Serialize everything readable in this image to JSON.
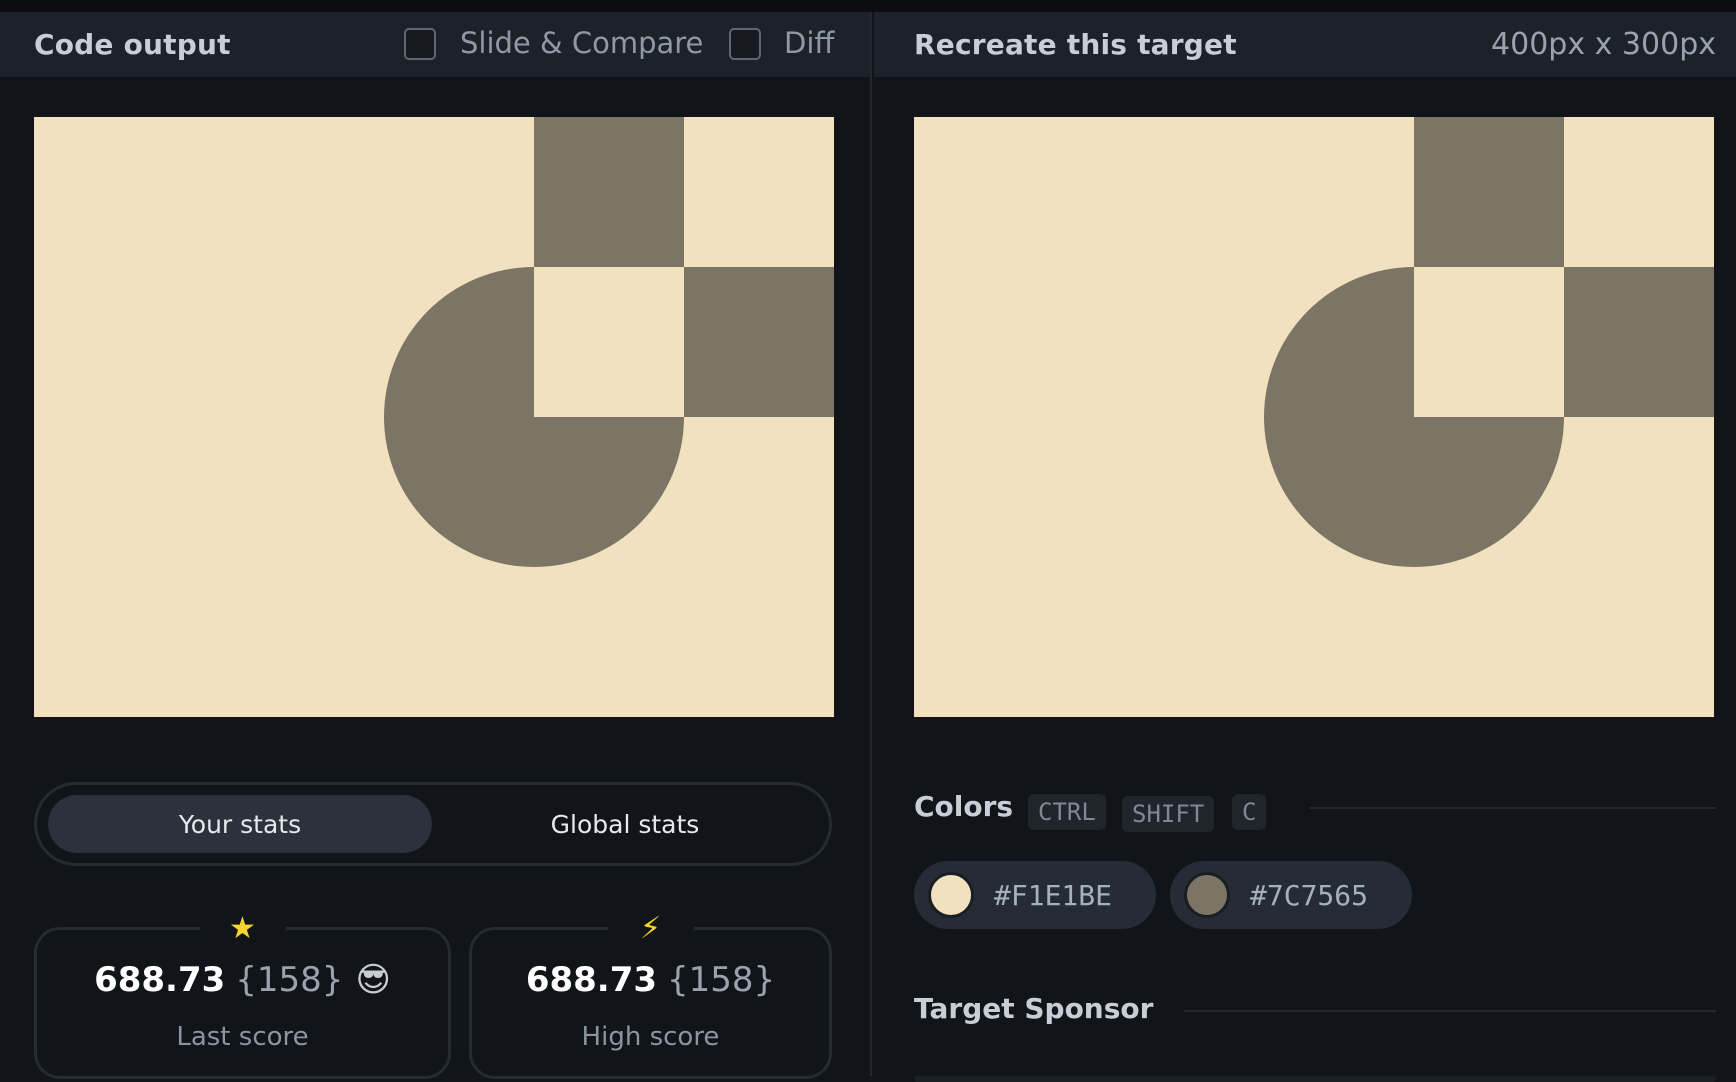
{
  "left_panel": {
    "title": "Code output",
    "slide_compare_label": "Slide & Compare",
    "diff_label": "Diff"
  },
  "right_panel": {
    "title": "Recreate this target",
    "dimensions": "400px x 300px"
  },
  "target_colors": {
    "background": "#F1E1BE",
    "foreground": "#7C7565"
  },
  "stats": {
    "tabs": [
      "Your stats",
      "Global stats"
    ],
    "active_tab": "Your stats",
    "last_score": {
      "icon": "star-icon",
      "value": "688.73",
      "count": "{158}",
      "emoji": "😎",
      "label": "Last score"
    },
    "high_score": {
      "icon": "lightning-icon",
      "value": "688.73",
      "count": "{158}",
      "label": "High score"
    }
  },
  "colors_section": {
    "title": "Colors",
    "shortcut_keys": [
      "CTRL",
      "SHIFT",
      "C"
    ],
    "swatches": [
      {
        "hex": "#F1E1BE"
      },
      {
        "hex": "#7C7565"
      }
    ]
  },
  "sponsor_section": {
    "title": "Target Sponsor"
  }
}
